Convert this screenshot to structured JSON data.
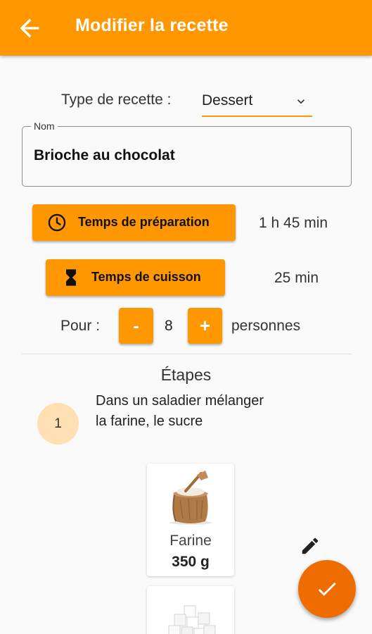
{
  "app_bar": {
    "title": "Modifier la recette",
    "back_icon": "arrow-left-icon",
    "background": "#ff9800"
  },
  "recipe_type": {
    "label": "Type de recette :",
    "value": "Dessert",
    "icon": "chevron-down-icon"
  },
  "name_field": {
    "label": "Nom",
    "value": "Brioche au chocolat"
  },
  "prep_time": {
    "button_label": "Temps de préparation",
    "icon": "clock-icon",
    "value": "1 h 45 min"
  },
  "cook_time": {
    "button_label": "Temps de cuisson",
    "icon": "hourglass-icon",
    "value": "25 min"
  },
  "servings": {
    "label": "Pour :",
    "decrement_label": "-",
    "count": "8",
    "increment_label": "+",
    "unit": "personnes"
  },
  "steps": {
    "title": "Étapes",
    "items": [
      {
        "number": "1",
        "text": "Dans un saladier mélanger la farine, le sucre",
        "ingredients": [
          {
            "name": "Farine",
            "quantity": "350 g",
            "icon": "flour-sack-icon"
          },
          {
            "name": "",
            "quantity": "",
            "icon": "sugar-cubes-icon"
          }
        ]
      }
    ]
  },
  "actions": {
    "edit_icon": "pencil-icon",
    "fab_icon": "check-icon",
    "fab_color": "#ef6c00"
  }
}
